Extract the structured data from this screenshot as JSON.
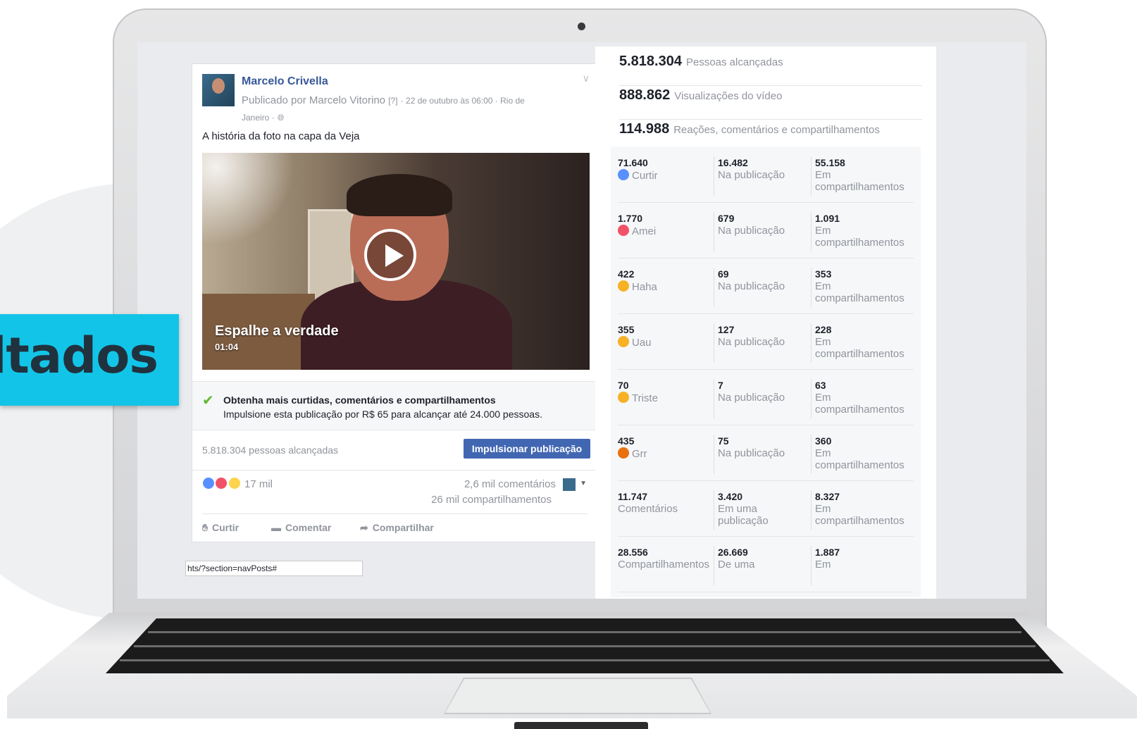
{
  "banner": {
    "text": "ltados"
  },
  "post": {
    "author": "Marcelo Crivella",
    "meta_prefix": "Publicado por Marcelo Vitorino",
    "meta_help": "[?]",
    "meta_date": "· 22 de outubro às 06:00 · Rio de",
    "meta_location": "Janeiro ·",
    "text": "A história da foto na capa da Veja",
    "video": {
      "title": "Espalhe a verdade",
      "duration": "01:04"
    },
    "promo": {
      "title": "Obtenha mais curtidas, comentários e compartilhamentos",
      "subtitle": "Impulsione esta publicação por R$ 65 para alcançar até 24.000 pessoas."
    },
    "reach": "5.818.304 pessoas alcançadas",
    "boost_label": "Impulsionar publicação",
    "reactions_count": "17 mil",
    "comments_count": "2,6 mil comentários",
    "shares_count": "26 mil compartilhamentos",
    "actions": {
      "like": "Curtir",
      "comment": "Comentar",
      "share": "Compartilhar"
    }
  },
  "status_url": "hts/?section=navPosts#",
  "stats": {
    "reached": {
      "value": "5.818.304",
      "label": "Pessoas alcançadas"
    },
    "views": {
      "value": "888.862",
      "label": "Visualizações do vídeo"
    },
    "engagement": {
      "value": "114.988",
      "label": "Reações, comentários e compartilhamentos"
    },
    "rows": [
      {
        "total": "71.640",
        "name": "Curtir",
        "icon": "like-icon",
        "color": "#5890ff",
        "post": "16.482",
        "post_label": "Na publicação",
        "shares": "55.158",
        "shares_label_1": "Em",
        "shares_label_2": "compartilhamentos"
      },
      {
        "total": "1.770",
        "name": "Amei",
        "icon": "love-icon",
        "color": "#f25268",
        "post": "679",
        "post_label": "Na publicação",
        "shares": "1.091",
        "shares_label_1": "Em",
        "shares_label_2": "compartilhamentos"
      },
      {
        "total": "422",
        "name": "Haha",
        "icon": "haha-icon",
        "color": "#f7b125",
        "post": "69",
        "post_label": "Na publicação",
        "shares": "353",
        "shares_label_1": "Em",
        "shares_label_2": "compartilhamentos"
      },
      {
        "total": "355",
        "name": "Uau",
        "icon": "wow-icon",
        "color": "#f7b125",
        "post": "127",
        "post_label": "Na publicação",
        "shares": "228",
        "shares_label_1": "Em",
        "shares_label_2": "compartilhamentos"
      },
      {
        "total": "70",
        "name": "Triste",
        "icon": "sad-icon",
        "color": "#f7b125",
        "post": "7",
        "post_label": "Na publicação",
        "shares": "63",
        "shares_label_1": "Em",
        "shares_label_2": "compartilhamentos"
      },
      {
        "total": "435",
        "name": "Grr",
        "icon": "angry-icon",
        "color": "#e9710f",
        "post": "75",
        "post_label": "Na publicação",
        "shares": "360",
        "shares_label_1": "Em",
        "shares_label_2": "compartilhamentos"
      },
      {
        "total": "11.747",
        "name": "Comentários",
        "icon": "",
        "color": "",
        "post": "3.420",
        "post_label": "Em uma",
        "post_label_2": "publicação",
        "shares": "8.327",
        "shares_label_1": "Em",
        "shares_label_2": "compartilhamentos"
      },
      {
        "total": "28.556",
        "name": "Compartilhamentos",
        "icon": "",
        "color": "",
        "post": "26.669",
        "post_label": "De uma",
        "shares": "1.887",
        "shares_label_1": "Em",
        "shares_label_2": ""
      }
    ]
  }
}
